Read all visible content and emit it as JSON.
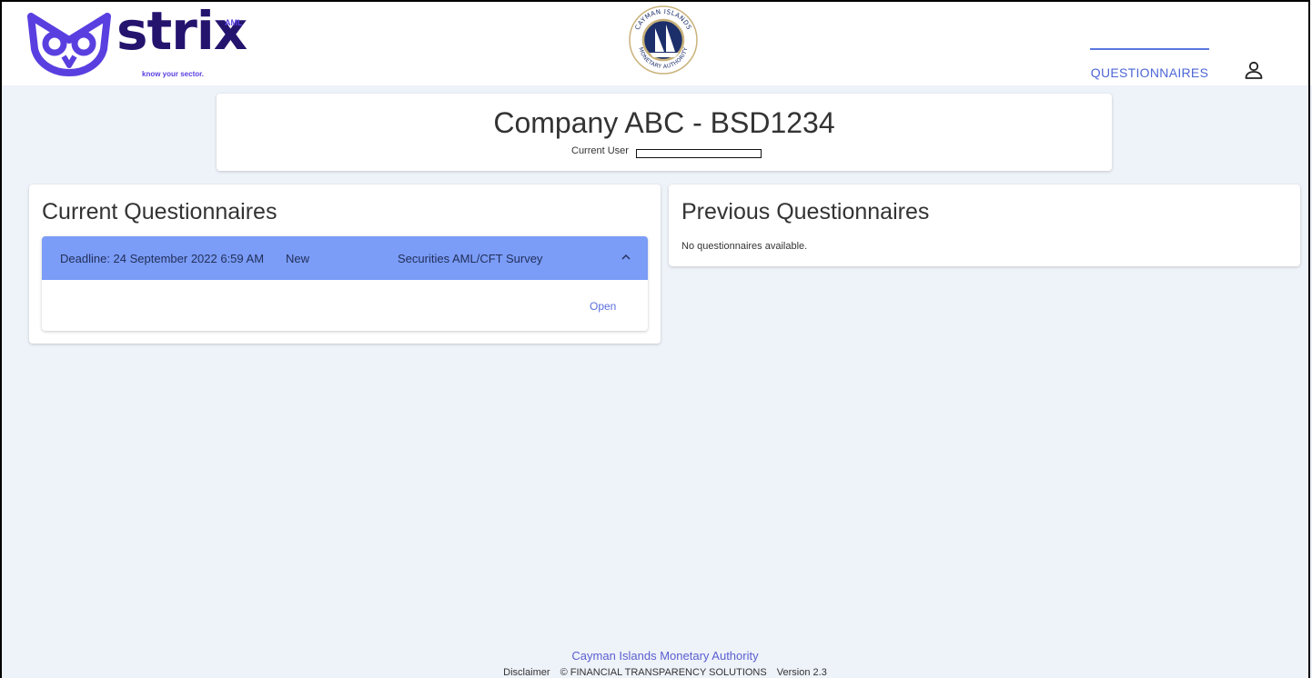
{
  "header": {
    "logo_word": "strix",
    "logo_superscript": "AML",
    "logo_tagline": "know your sector.",
    "seal_text_top": "CAYMAN ISLANDS",
    "seal_text_bottom": "MONETARY AUTHORITY",
    "nav_tab": "QUESTIONNAIRES",
    "user_icon": "user-icon"
  },
  "company": {
    "title": "Company ABC - BSD1234",
    "current_user_label": "Current User"
  },
  "current": {
    "title": "Current Questionnaires",
    "items": [
      {
        "deadline": "Deadline: 24 September 2022 6:59 AM",
        "status": "New",
        "name": "Securities AML/CFT Survey",
        "action": "Open"
      }
    ]
  },
  "previous": {
    "title": "Previous Questionnaires",
    "empty": "No questionnaires available."
  },
  "footer": {
    "authority": "Cayman Islands Monetary Authority",
    "disclaimer": "Disclaimer",
    "copyright": "© FINANCIAL TRANSPARENCY SOLUTIONS",
    "version": "Version 2.3"
  },
  "colors": {
    "brand_dark": "#24146e",
    "brand_accent": "#5a3fe0",
    "item_header": "#7b9cf7",
    "nav_active": "#4d66d6",
    "background": "#eef2f9"
  }
}
